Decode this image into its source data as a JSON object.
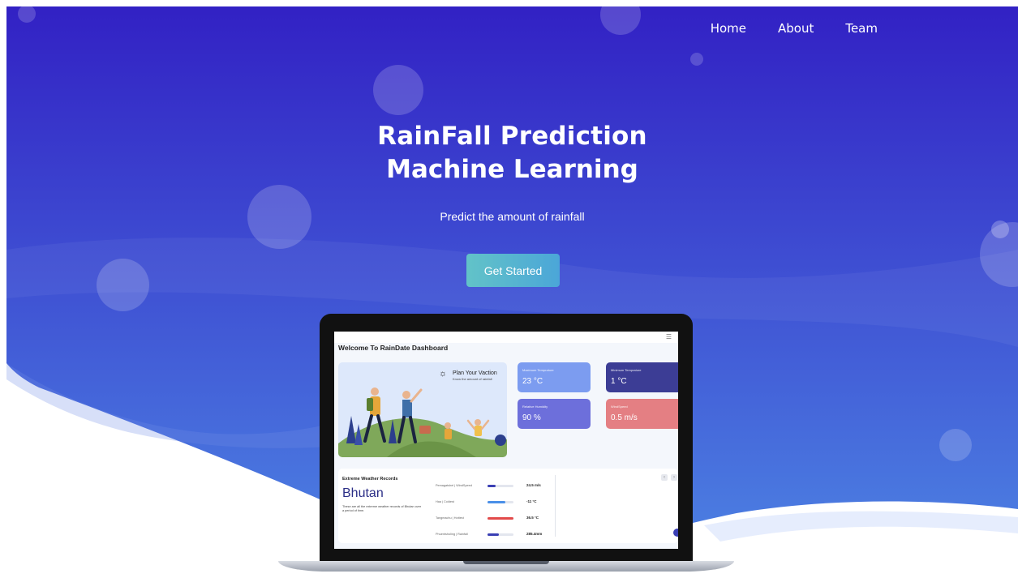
{
  "nav": {
    "items": [
      {
        "label": "Home"
      },
      {
        "label": "About"
      },
      {
        "label": "Team"
      }
    ]
  },
  "hero": {
    "title": "RainFall Prediction",
    "subtitle": "Machine Learning",
    "tagline": "Predict the amount of rainfall",
    "cta_label": "Get Started"
  },
  "dashboard": {
    "header": "Welcome To RainDate Dashboard",
    "plan": {
      "title": "Plan Your Vaction",
      "subtitle": "Know the amount of rainfall"
    },
    "stats": [
      {
        "label": "Maximum Temprature",
        "value": "23 °C",
        "color": "#7c9cf0"
      },
      {
        "label": "Minimum Temprature",
        "value": "1 °C",
        "color": "#3c3d95"
      },
      {
        "label": "Relative Humidity",
        "value": "90 %",
        "color": "#6d6fdb"
      },
      {
        "label": "WindSpeed",
        "value": "0.5 m/s",
        "color": "#e47f83"
      }
    ],
    "records": {
      "title": "Extreme Weather Records",
      "country": "Bhutan",
      "description": "These are all the extreme weather records of Bhutan over a period of time.",
      "rows": [
        {
          "label": "Pemagatshel | WindSpeed",
          "value": "24.5 m/s",
          "fill": 0.3,
          "color": "#3a3fb4"
        },
        {
          "label": "Haa | Coldest",
          "value": "-11 °C",
          "fill": 0.7,
          "color": "#4a90e8"
        },
        {
          "label": "Tangmachu | Hottest",
          "value": "36.5 °C",
          "fill": 1.0,
          "color": "#e24a4a"
        },
        {
          "label": "Phuentsholing | Rainfall",
          "value": "285.4mm",
          "fill": 0.45,
          "color": "#3a3fb4"
        }
      ]
    }
  },
  "colors": {
    "gradient_top": "#3221c4",
    "gradient_bottom": "#4c80e2",
    "button": "#58b4d0"
  }
}
